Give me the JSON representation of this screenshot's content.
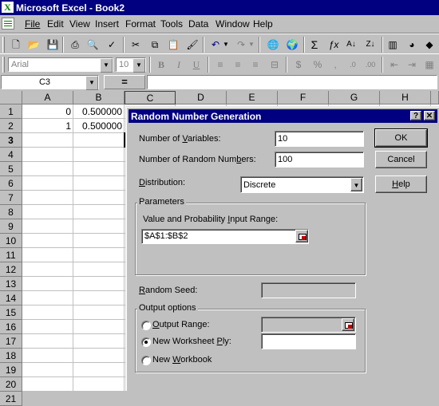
{
  "window": {
    "title": "Microsoft Excel - Book2",
    "app_icon": "excel-x-icon"
  },
  "menu": [
    "File",
    "Edit",
    "View",
    "Insert",
    "Format",
    "Tools",
    "Data",
    "Window",
    "Help"
  ],
  "formatting": {
    "font": "Arial",
    "size": "10"
  },
  "name_box": "C3",
  "formula_symbol": "=",
  "columns": [
    "A",
    "B",
    "C",
    "D",
    "E",
    "F",
    "G",
    "H"
  ],
  "rows": [
    "1",
    "2",
    "3",
    "4",
    "5",
    "6",
    "7",
    "8",
    "9",
    "10",
    "11",
    "12",
    "13",
    "14",
    "15",
    "16",
    "17",
    "18",
    "19",
    "20",
    "21"
  ],
  "cells": {
    "A1": "0",
    "B1": "0.500000",
    "A2": "1",
    "B2": "0.500000"
  },
  "dialog": {
    "title": "Random Number Generation",
    "help_glyph": "?",
    "close_glyph": "✕",
    "num_variables": {
      "label_pre": "Number of ",
      "label_u": "V",
      "label_post": "ariables:",
      "value": "10"
    },
    "num_random": {
      "label_pre": "Number of Random Num",
      "label_u": "b",
      "label_post": "ers:",
      "value": "100"
    },
    "distribution": {
      "label_pre": "",
      "label_u": "D",
      "label_post": "istribution:",
      "value": "Discrete"
    },
    "ok": "OK",
    "cancel": "Cancel",
    "help": {
      "u": "H",
      "rest": "elp"
    },
    "parameters": {
      "title": "Parameters",
      "range_label_pre": "Value and Probability ",
      "range_label_u": "I",
      "range_label_post": "nput Range:",
      "range_value": "$A$1:$B$2"
    },
    "random_seed": {
      "label_pre": "",
      "label_u": "R",
      "label_post": "andom Seed:",
      "value": ""
    },
    "output": {
      "title": "Output options",
      "output_range": {
        "pre": "",
        "u": "O",
        "post": "utput Range:",
        "value": ""
      },
      "new_sheet": {
        "pre": "New Worksheet ",
        "u": "P",
        "post": "ly:",
        "value": "",
        "selected": true
      },
      "new_workbook": {
        "pre": "New ",
        "u": "W",
        "post": "orkbook"
      }
    }
  },
  "colors": {
    "titlebar": "#000080",
    "face": "#c0c0c0",
    "accent_red": "#c00000"
  }
}
